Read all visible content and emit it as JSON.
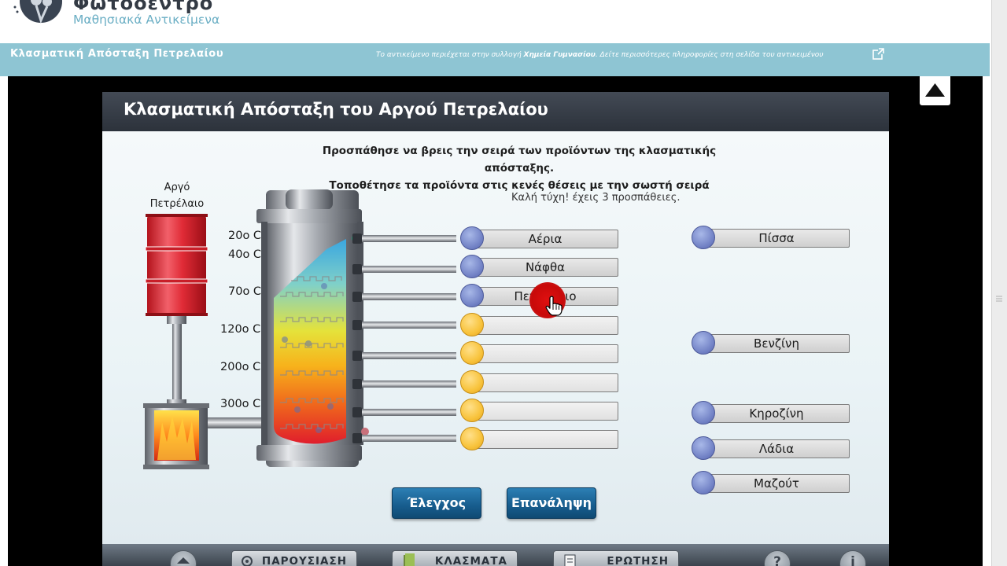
{
  "site": {
    "title": "Φωτόδεντρο",
    "subtitle": "Μαθησιακά Αντικείμενα"
  },
  "bluebar": {
    "title": "Κλασματική Απόσταξη Πετρελαίου",
    "info_prefix": "Το αντικείμενο περιέχεται στην συλλογή ",
    "info_collection": "Χημεία Γυμνασίου",
    "info_suffix": ". Δείτε περισσότερες πληροφορίες στη σελίδα του αντικειμένου"
  },
  "app": {
    "title": "Κλασματική Απόσταξη του Αργού Πετρελαίου",
    "instruction_line1": "Προσπάθησε να βρεις την σειρά των προϊόντων της κλασματικής απόσταξης.",
    "instruction_line2": "Τοποθέτησε τα προϊόντα στις κενές θέσεις με την σωστή σειρά",
    "attempts_text": "Καλή τύχη! έχεις 3 προσπάθειες.",
    "crude_oil_label_1": "Αργό",
    "crude_oil_label_2": "Πετρέλαιο",
    "temperatures": [
      "20ο C",
      "40ο C",
      "70ο C",
      "120ο C",
      "200ο C",
      "300ο C"
    ],
    "placed_slots": [
      "Αέρια",
      "Νάφθα",
      "Πετρέλαιο",
      "",
      "",
      "",
      "",
      ""
    ],
    "available_products": [
      "Πίσσα",
      "Βενζίνη",
      "Κηροζίνη",
      "Λάδια",
      "Μαζούτ"
    ],
    "check_button": "Έλεγχος",
    "retry_button": "Επανάληψη",
    "nav": {
      "presentation": "ΠΑΡΟΥΣΙΑΣΗ",
      "fractions": "ΚΛΑΣΜΑΤΑ",
      "question": "ΕΡΩΤΗΣΗ",
      "help": "?",
      "info": "i"
    }
  },
  "colors": {
    "bluebar": "#8ec5d3",
    "app_title_bg": "#2c323b",
    "button_blue": "#175c8d",
    "slot_blue_circle": "#7686c8",
    "slot_yellow_circle": "#f8c33c",
    "drag_dot": "#c80a0a"
  },
  "icons": {
    "logo": "photodentro-logo-icon",
    "external": "external-link-icon",
    "up": "arrow-up-icon",
    "cursor": "hand-pointer-icon"
  }
}
